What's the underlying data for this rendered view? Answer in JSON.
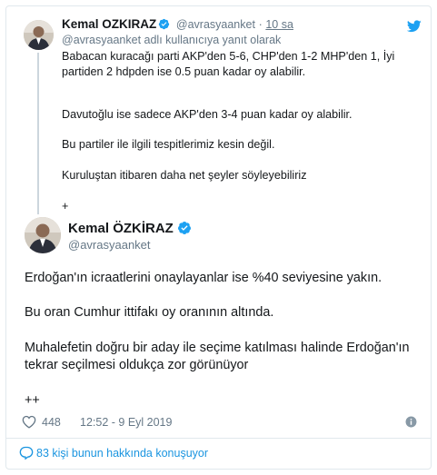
{
  "reply_tweet": {
    "name": "Kemal OZKIRAZ",
    "handle": "@avrasyaanket",
    "dot": "·",
    "time": "10 sa",
    "reply_to": "@avrasyaanket adlı kullanıcıya yanıt olarak",
    "paragraphs": [
      "Babacan kuracağı parti AKP'den 5-6, CHP'den 1-2 MHP'den 1, İyi partiden 2 hdpden ise 0.5 puan kadar oy alabilir.",
      "Davutoğlu ise sadece AKP'den 3-4 puan kadar oy alabilir.",
      "Bu partiler ile ilgili tespitlerimiz kesin değil.",
      "Kuruluştan itibaren daha net şeyler söyleyebiliriz",
      "+"
    ]
  },
  "main_tweet": {
    "name": "Kemal ÖZKİRAZ",
    "handle": "@avrasyaanket",
    "paragraphs": [
      "Erdoğan'ın icraatlerini onaylayanlar ise %40 seviyesine yakın.",
      "Bu oran Cumhur ittifakı oy oranının altında.",
      "Muhalefetin doğru bir aday ile seçime katılması halinde Erdoğan'ın tekrar seçilmesi oldukça zor görünüyor",
      "++"
    ],
    "likes": "448",
    "timestamp": "12:52 - 9 Eyl 2019"
  },
  "footer": {
    "discuss_label": "83 kişi bunun hakkında konuşuyor"
  },
  "colors": {
    "twitter_blue": "#1da1f2",
    "link_blue": "#1b95e0",
    "secondary_text": "#657786",
    "border": "#e1e8ed"
  },
  "icons": [
    "twitter-logo-icon",
    "verified-badge-icon",
    "heart-icon",
    "info-icon",
    "speech-bubble-icon"
  ]
}
